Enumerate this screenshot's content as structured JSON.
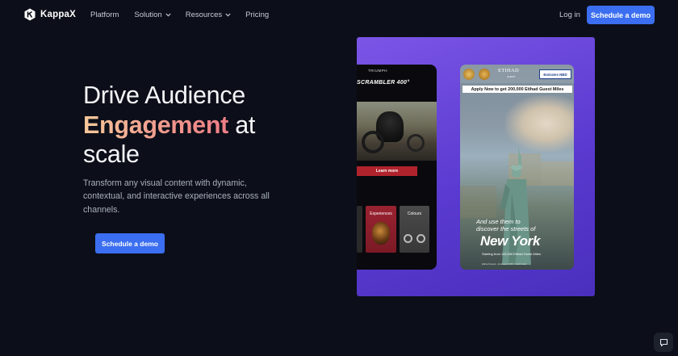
{
  "nav": {
    "brand": "KappaX",
    "links": [
      {
        "label": "Platform",
        "has_dropdown": false
      },
      {
        "label": "Solution",
        "has_dropdown": true
      },
      {
        "label": "Resources",
        "has_dropdown": true
      },
      {
        "label": "Pricing",
        "has_dropdown": false
      }
    ],
    "login_label": "Log in",
    "cta_label": "Schedule a demo"
  },
  "hero": {
    "title_line1": "Drive Audience",
    "title_highlight": "Engagement",
    "title_rest": "at scale",
    "subtitle": "Transform any visual content with dynamic, contextual, and interactive experiences across all channels.",
    "cta_label": "Schedule a demo"
  },
  "showcase": {
    "left_phone": {
      "brand": "TRIUMPH",
      "model": "SCRAMBLER 400°",
      "learn_more": "Learn more",
      "card_experiences": "Experiences",
      "card_colours": "Colours"
    },
    "right_phone": {
      "partner_etihad": "ETIHAD",
      "partner_etihad_sub": "GUEST",
      "partner_bank": "Emirates NBD",
      "apply_banner": "Apply Now to get 200,000 Etihad Guest Miles",
      "tagline_1": "And use them to",
      "tagline_2": "discover the streets of",
      "city": "New York",
      "starting": "Starting from 115,500 Etihad Guest Miles",
      "fine_print": "Etihad Guest - Emirates NBD Credit Card"
    }
  },
  "colors": {
    "background": "#0c0f19",
    "accent": "#3b6ef0",
    "gradient_start": "#f7c89a",
    "gradient_end": "#ef7d86",
    "showcase_purple": "#6b47dc"
  },
  "icons": {
    "logo": "kappax-logo-icon",
    "dropdown": "chevron-down-icon",
    "chat": "chat-bubble-icon"
  }
}
